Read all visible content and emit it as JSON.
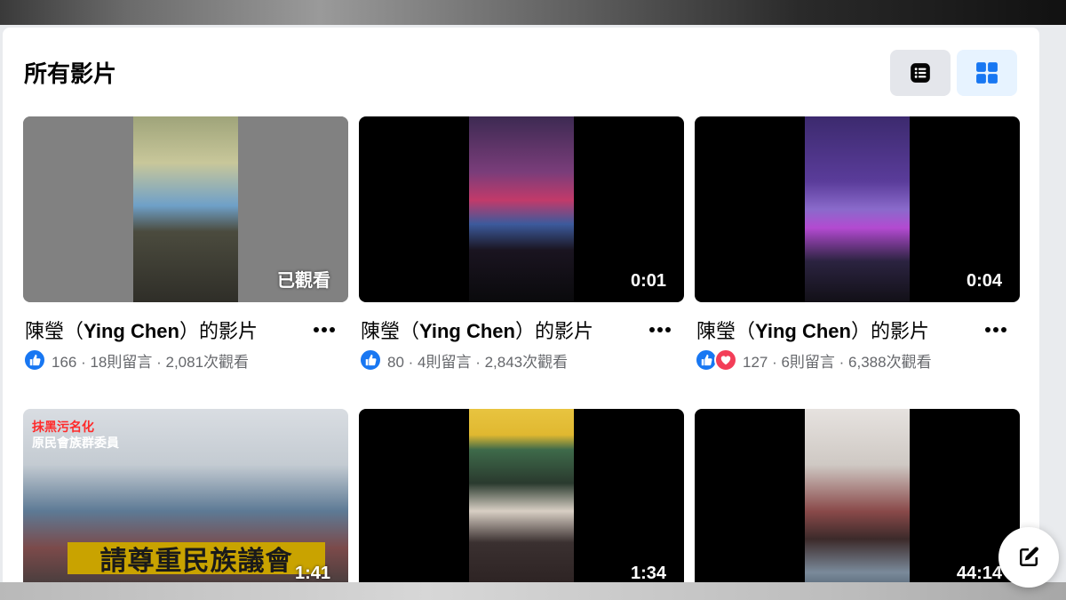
{
  "page": {
    "title": "所有影片",
    "view_toggle": [
      {
        "name": "list-view",
        "icon": "list-icon",
        "active": false
      },
      {
        "name": "grid-view",
        "icon": "grid-icon",
        "active": true
      }
    ]
  },
  "videos": [
    {
      "title_prefix": "陳瑩（",
      "title_name": "Ying Chen",
      "title_suffix": "）的影片",
      "badge": "已觀看",
      "reactions": [
        "like"
      ],
      "stats": "166 · 18則留言 · 2,081次觀看"
    },
    {
      "title_prefix": "陳瑩（",
      "title_name": "Ying Chen",
      "title_suffix": "）的影片",
      "badge": "0:01",
      "reactions": [
        "like"
      ],
      "stats": "80 · 4則留言 · 2,843次觀看"
    },
    {
      "title_prefix": "陳瑩（",
      "title_name": "Ying Chen",
      "title_suffix": "）的影片",
      "badge": "0:04",
      "reactions": [
        "like",
        "love"
      ],
      "stats": "127 · 6則留言 · 6,388次觀看"
    },
    {
      "badge": "1:41",
      "overlay_red": "抹黑污名化",
      "overlay_white": "原民會族群委員",
      "overlay_caption": "請尊重民族議會"
    },
    {
      "badge": "1:34"
    },
    {
      "badge": "44:14"
    }
  ],
  "colors": {
    "accent": "#1877f2",
    "love": "#f33e58",
    "text_primary": "#050505",
    "text_secondary": "#65676b"
  },
  "icons": {
    "more": "more-horizontal-icon",
    "like": "thumbs-up-icon",
    "love": "heart-icon",
    "edit": "compose-icon"
  }
}
